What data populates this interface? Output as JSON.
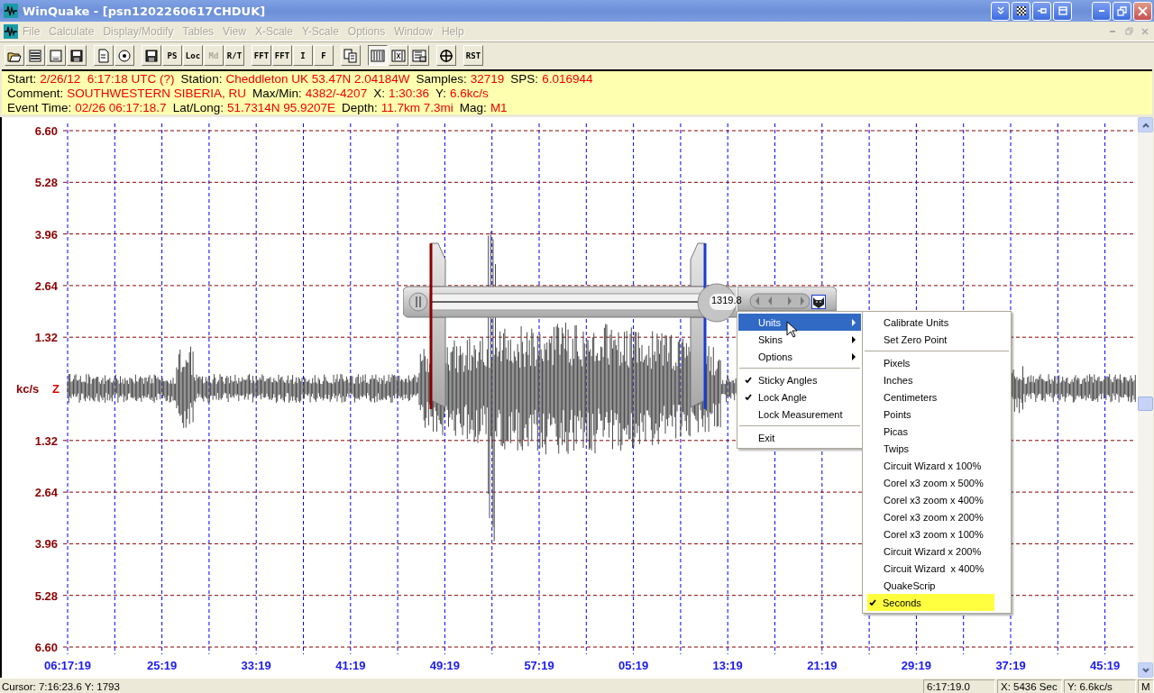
{
  "window": {
    "title": "WinQuake - [psn1202260617CHDUK]"
  },
  "menu_bar": [
    {
      "label": "File",
      "disabled": true
    },
    {
      "label": "Calculate",
      "disabled": true
    },
    {
      "label": "Display/Modify",
      "disabled": true
    },
    {
      "label": "Tables",
      "disabled": true
    },
    {
      "label": "View",
      "disabled": true
    },
    {
      "label": "X-Scale",
      "disabled": true
    },
    {
      "label": "Y-Scale",
      "disabled": true
    },
    {
      "label": "Options",
      "disabled": true
    },
    {
      "label": "Window",
      "disabled": true
    },
    {
      "label": "Help",
      "disabled": true
    }
  ],
  "toolbar": [
    [
      {
        "kind": "icon",
        "disabled": false,
        "pressed": false
      },
      {
        "kind": "icon",
        "disabled": false,
        "pressed": false
      },
      {
        "kind": "icon",
        "disabled": false,
        "pressed": false
      },
      {
        "kind": "icon",
        "disabled": false,
        "pressed": false
      }
    ],
    [
      {
        "kind": "icon",
        "disabled": false,
        "pressed": false
      },
      {
        "kind": "icon",
        "disabled": false,
        "pressed": false
      }
    ],
    [
      {
        "kind": "icon",
        "disabled": false,
        "pressed": false
      },
      {
        "kind": "text",
        "label": "PS",
        "disabled": false,
        "pressed": false
      },
      {
        "kind": "text",
        "label": "Loc",
        "disabled": false,
        "pressed": false
      },
      {
        "kind": "text",
        "label": "Md",
        "disabled": true,
        "pressed": false
      },
      {
        "kind": "text",
        "label": "R/T",
        "disabled": false,
        "pressed": false
      }
    ],
    [
      {
        "kind": "text",
        "label": "FFT",
        "disabled": false,
        "pressed": false
      },
      {
        "kind": "text",
        "label": "FFT",
        "disabled": false,
        "pressed": false
      },
      {
        "kind": "text",
        "label": "I",
        "disabled": false,
        "pressed": false
      },
      {
        "kind": "text",
        "label": "F",
        "disabled": false,
        "pressed": false
      }
    ],
    [
      {
        "kind": "icon",
        "disabled": false,
        "pressed": false
      }
    ],
    [
      {
        "kind": "icon",
        "disabled": false,
        "pressed": true
      },
      {
        "kind": "icon",
        "disabled": false,
        "pressed": false
      },
      {
        "kind": "icon",
        "disabled": false,
        "pressed": false
      }
    ],
    [
      {
        "kind": "icon",
        "disabled": false,
        "pressed": false
      }
    ],
    [
      {
        "kind": "text",
        "label": "RST",
        "disabled": false,
        "pressed": false
      }
    ]
  ],
  "info_panel": [
    [
      {
        "label": "Start:",
        "value": "2/26/12  6:17:18 UTC (?)"
      },
      {
        "label": "Station:",
        "value": "Cheddleton UK 53.47N 2.04184W"
      },
      {
        "label": "Samples:",
        "value": "32719"
      },
      {
        "label": "SPS:",
        "value": "6.016944"
      }
    ],
    [
      {
        "label": "Comment:",
        "value": "SOUTHWESTERN SIBERIA, RU"
      },
      {
        "label": "Max/Min:",
        "value": "4382/-4207"
      },
      {
        "label": "X:",
        "value": "1:30:36"
      },
      {
        "label": "Y:",
        "value": "6.6kc/s"
      }
    ],
    [
      {
        "label": "Event Time:",
        "value": "02/26 06:17:18.7"
      },
      {
        "label": "Lat/Long:",
        "value": "51.7314N 95.9207E"
      },
      {
        "label": "Depth:",
        "value": "11.7km 7.3mi"
      },
      {
        "label": "Mag:",
        "value": "M1"
      }
    ]
  ],
  "chart": {
    "y_labels": [
      "6.60",
      "5.28",
      "3.96",
      "2.64",
      "1.32",
      "1.32",
      "2.64",
      "3.96",
      "5.28",
      "6.60"
    ],
    "unit": "kc/s",
    "channel": "Z",
    "x_labels": [
      "06:17:19",
      "25:19",
      "33:19",
      "41:19",
      "49:19",
      "57:19",
      "05:19",
      "13:19",
      "21:19",
      "29:19",
      "37:19",
      "45:19"
    ]
  },
  "caliper": {
    "reading": "1319.8"
  },
  "context_menu": [
    {
      "kind": "item",
      "label": "Units",
      "submenu": true,
      "checked": false,
      "selected": true
    },
    {
      "kind": "item",
      "label": "Skins",
      "submenu": true,
      "checked": false,
      "selected": false
    },
    {
      "kind": "item",
      "label": "Options",
      "submenu": true,
      "checked": false,
      "selected": false
    },
    {
      "kind": "separator"
    },
    {
      "kind": "item",
      "label": "Sticky Angles",
      "submenu": false,
      "checked": true,
      "selected": false
    },
    {
      "kind": "item",
      "label": "Lock Angle",
      "submenu": false,
      "checked": true,
      "selected": false
    },
    {
      "kind": "item",
      "label": "Lock Measurement",
      "submenu": false,
      "checked": false,
      "selected": false
    },
    {
      "kind": "separator"
    },
    {
      "kind": "item",
      "label": "Exit",
      "submenu": false,
      "checked": false,
      "selected": false
    }
  ],
  "units_submenu": [
    {
      "kind": "item",
      "label": "Calibrate Units",
      "checked": false,
      "selected": false
    },
    {
      "kind": "item",
      "label": "Set Zero Point",
      "checked": false,
      "selected": false
    },
    {
      "kind": "separator"
    },
    {
      "kind": "item",
      "label": "Pixels",
      "checked": false,
      "selected": false
    },
    {
      "kind": "item",
      "label": "Inches",
      "checked": false,
      "selected": false
    },
    {
      "kind": "item",
      "label": "Centimeters",
      "checked": false,
      "selected": false
    },
    {
      "kind": "item",
      "label": "Points",
      "checked": false,
      "selected": false
    },
    {
      "kind": "item",
      "label": "Picas",
      "checked": false,
      "selected": false
    },
    {
      "kind": "item",
      "label": "Twips",
      "checked": false,
      "selected": false
    },
    {
      "kind": "item",
      "label": "Circuit Wizard x 100%",
      "checked": false,
      "selected": false
    },
    {
      "kind": "item",
      "label": "Corel x3 zoom x 500%",
      "checked": false,
      "selected": false
    },
    {
      "kind": "item",
      "label": "Corel x3 zoom x 400%",
      "checked": false,
      "selected": false
    },
    {
      "kind": "item",
      "label": "Corel x3 zoom x 200%",
      "checked": false,
      "selected": false
    },
    {
      "kind": "item",
      "label": "Corel x3 zoom x 100%",
      "checked": false,
      "selected": false
    },
    {
      "kind": "item",
      "label": "Circuit Wizard x 200%",
      "checked": false,
      "selected": false
    },
    {
      "kind": "item",
      "label": "Circuit Wizard  x 400%",
      "checked": false,
      "selected": false
    },
    {
      "kind": "item",
      "label": "QuakeScrip",
      "checked": false,
      "selected": false
    },
    {
      "kind": "item",
      "label": "Seconds",
      "checked": true,
      "selected": true
    }
  ],
  "status_bar": {
    "cursor": "Cursor: 7:16:23.6  Y: 1793",
    "panels": [
      "6:17:19.0",
      "X: 5436 Sec",
      "Y: 6.6kc/s",
      "M"
    ]
  }
}
